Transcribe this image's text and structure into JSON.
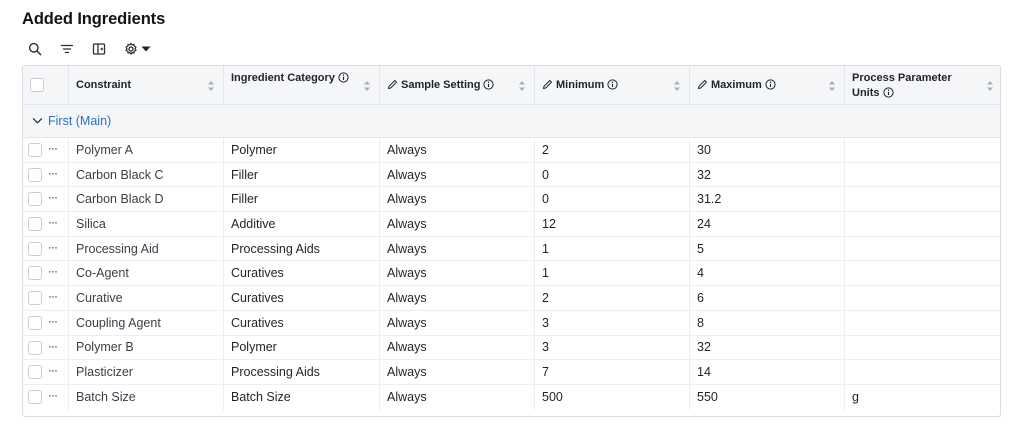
{
  "page": {
    "title": "Added Ingredients"
  },
  "toolbar": {
    "icons": [
      "search-icon",
      "filter-icon",
      "columns-icon",
      "gear-icon",
      "caret-down-icon"
    ]
  },
  "columns": [
    {
      "label": "Constraint",
      "info": false,
      "editable": false
    },
    {
      "label": "Ingredient Category",
      "info": true,
      "editable": false
    },
    {
      "label": "Sample Setting",
      "info": true,
      "editable": true
    },
    {
      "label": "Minimum",
      "info": true,
      "editable": true
    },
    {
      "label": "Maximum",
      "info": true,
      "editable": true
    },
    {
      "label": "Process Parameter Units",
      "info": true,
      "editable": false
    }
  ],
  "group": {
    "label": "First (Main)"
  },
  "rows": [
    {
      "constraint": "Polymer A",
      "category": "Polymer",
      "setting": "Always",
      "min": "2",
      "max": "30",
      "units": ""
    },
    {
      "constraint": "Carbon Black C",
      "category": "Filler",
      "setting": "Always",
      "min": "0",
      "max": "32",
      "units": ""
    },
    {
      "constraint": "Carbon Black D",
      "category": "Filler",
      "setting": "Always",
      "min": "0",
      "max": "31.2",
      "units": ""
    },
    {
      "constraint": "Silica",
      "category": "Additive",
      "setting": "Always",
      "min": "12",
      "max": "24",
      "units": ""
    },
    {
      "constraint": "Processing Aid",
      "category": "Processing Aids",
      "setting": "Always",
      "min": "1",
      "max": "5",
      "units": ""
    },
    {
      "constraint": "Co-Agent",
      "category": "Curatives",
      "setting": "Always",
      "min": "1",
      "max": "4",
      "units": ""
    },
    {
      "constraint": "Curative",
      "category": "Curatives",
      "setting": "Always",
      "min": "2",
      "max": "6",
      "units": ""
    },
    {
      "constraint": "Coupling Agent",
      "category": "Curatives",
      "setting": "Always",
      "min": "3",
      "max": "8",
      "units": ""
    },
    {
      "constraint": "Polymer B",
      "category": "Polymer",
      "setting": "Always",
      "min": "3",
      "max": "32",
      "units": ""
    },
    {
      "constraint": "Plasticizer",
      "category": "Processing Aids",
      "setting": "Always",
      "min": "7",
      "max": "14",
      "units": ""
    },
    {
      "constraint": "Batch Size",
      "category": "Batch Size",
      "setting": "Always",
      "min": "500",
      "max": "550",
      "units": "g"
    }
  ],
  "row_actions_glyph": "···",
  "colors": {
    "accent": "#2a6fc4",
    "header_bg": "#f5f6f8",
    "border": "#d9dde3"
  }
}
